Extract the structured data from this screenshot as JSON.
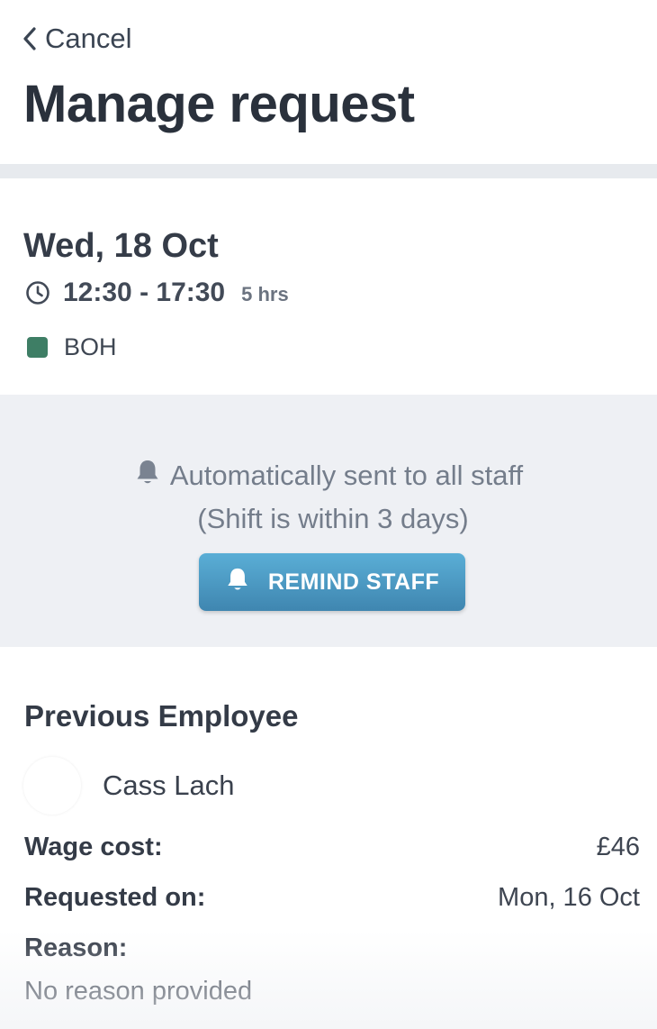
{
  "header": {
    "cancel_label": "Cancel",
    "title": "Manage request"
  },
  "shift": {
    "date": "Wed, 18 Oct",
    "time_range": "12:30 - 17:30",
    "duration": "5 hrs",
    "area": "BOH",
    "area_color": "#3e7e65"
  },
  "notification": {
    "message": "Automatically sent to all staff",
    "note": "(Shift is within 3 days)",
    "remind_button_label": "REMIND STAFF",
    "button_color": "#4a9ac5"
  },
  "previous_employee": {
    "heading": "Previous Employee",
    "name": "Cass Lach",
    "wage_label": "Wage cost:",
    "wage_value": "£46",
    "requested_label": "Requested on:",
    "requested_value": "Mon, 16 Oct",
    "reason_label": "Reason:",
    "reason_value": "No reason provided"
  },
  "icons": {
    "back": "chevron-left-icon",
    "clock": "clock-icon",
    "bell": "bell-icon"
  }
}
